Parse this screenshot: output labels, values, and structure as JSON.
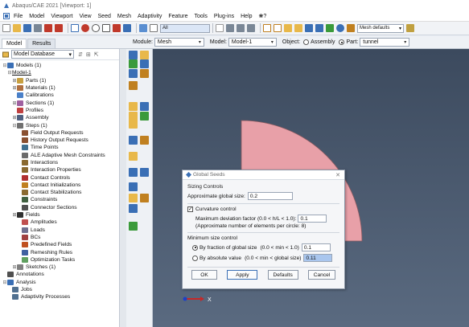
{
  "window": {
    "title": "Abaqus/CAE 2021 [Viewport: 1]"
  },
  "menubar": {
    "items": [
      "File",
      "Model",
      "Viewport",
      "View",
      "Seed",
      "Mesh",
      "Adaptivity",
      "Feature",
      "Tools",
      "Plug-ins",
      "Help",
      "❀?"
    ]
  },
  "toolbar": {
    "filter_value": "All",
    "mesh_defaults": "Mesh defaults"
  },
  "tabs": [
    {
      "label": "Model"
    },
    {
      "label": "Results"
    }
  ],
  "context": {
    "module_label": "Module:",
    "module_value": "Mesh",
    "model_label": "Model:",
    "model_value": "Model-1",
    "object_label": "Object:",
    "assembly_label": "Assembly",
    "part_label": "Part:",
    "part_value": "tunnel"
  },
  "tree": {
    "header": "Model Database",
    "nodes": [
      {
        "label": "Models (1)",
        "level": 0,
        "exp": "⊟",
        "color": "#3a6fb5"
      },
      {
        "label": "Model-1",
        "level": 1,
        "exp": "⊟",
        "color": "",
        "underline": true
      },
      {
        "label": "Parts (1)",
        "level": 2,
        "exp": "⊞",
        "color": "#c8a040"
      },
      {
        "label": "Materials (1)",
        "level": 2,
        "exp": "⊞",
        "color": "#b07040"
      },
      {
        "label": "Calibrations",
        "level": 2,
        "exp": "",
        "color": "#4a80c8"
      },
      {
        "label": "Sections (1)",
        "level": 2,
        "exp": "⊞",
        "color": "#a060a0"
      },
      {
        "label": "Profiles",
        "level": 2,
        "exp": "",
        "color": "#c04040"
      },
      {
        "label": "Assembly",
        "level": 2,
        "exp": "⊞",
        "color": "#506080"
      },
      {
        "label": "Steps (1)",
        "level": 2,
        "exp": "⊟",
        "color": "#707070"
      },
      {
        "label": "Field Output Requests",
        "level": 3,
        "exp": "",
        "color": "#8a5030"
      },
      {
        "label": "History Output Requests",
        "level": 3,
        "exp": "",
        "color": "#8a5030"
      },
      {
        "label": "Time Points",
        "level": 3,
        "exp": "",
        "color": "#407090"
      },
      {
        "label": "ALE Adaptive Mesh Constraints",
        "level": 3,
        "exp": "",
        "color": "#6a6a6a"
      },
      {
        "label": "Interactions",
        "level": 3,
        "exp": "",
        "color": "#8a6a30"
      },
      {
        "label": "Interaction Properties",
        "level": 3,
        "exp": "",
        "color": "#8a6a30"
      },
      {
        "label": "Contact Controls",
        "level": 3,
        "exp": "",
        "color": "#b03030"
      },
      {
        "label": "Contact Initializations",
        "level": 3,
        "exp": "",
        "color": "#c08020"
      },
      {
        "label": "Contact Stabilizations",
        "level": 3,
        "exp": "",
        "color": "#8a6a30"
      },
      {
        "label": "Constraints",
        "level": 3,
        "exp": "",
        "color": "#406040"
      },
      {
        "label": "Connector Sections",
        "level": 3,
        "exp": "",
        "color": "#505050"
      },
      {
        "label": "Fields",
        "level": 2,
        "exp": "⊞",
        "color": "#303030"
      },
      {
        "label": "Amplitudes",
        "level": 3,
        "exp": "",
        "color": "#c05050"
      },
      {
        "label": "Loads",
        "level": 3,
        "exp": "",
        "color": "#707090"
      },
      {
        "label": "BCs",
        "level": 3,
        "exp": "",
        "color": "#a04040"
      },
      {
        "label": "Predefined Fields",
        "level": 3,
        "exp": "",
        "color": "#c05020"
      },
      {
        "label": "Remeshing Rules",
        "level": 3,
        "exp": "",
        "color": "#4060a0"
      },
      {
        "label": "Optimization Tasks",
        "level": 3,
        "exp": "",
        "color": "#60a060"
      },
      {
        "label": "Sketches (1)",
        "level": 2,
        "exp": "⊞",
        "color": "#808080"
      },
      {
        "label": "Annotations",
        "level": 0,
        "exp": "",
        "color": "#505050"
      },
      {
        "label": "Analysis",
        "level": 0,
        "exp": "⊟",
        "color": "#3a6fb5"
      },
      {
        "label": "Jobs",
        "level": 1,
        "exp": "",
        "color": "#507090"
      },
      {
        "label": "Adaptivity Processes",
        "level": 1,
        "exp": "",
        "color": "#507090"
      }
    ]
  },
  "dialog": {
    "title": "Global Seeds",
    "sizing_section": "Sizing Controls",
    "approx_size_label": "Approximate global size:",
    "approx_size_value": "0.2",
    "curvature_label": "Curvature control",
    "max_dev_label": "Maximum deviation factor (0.0 < h/L < 1.0):",
    "max_dev_value": "0.1",
    "approx_elements_note": "(Approximate number of elements per circle: 8)",
    "min_size_section": "Minimum size control",
    "by_fraction_label": "By fraction of global size",
    "by_fraction_range": "(0.0 < min < 1.0)",
    "by_fraction_value": "0.1",
    "by_absolute_label": "By absolute value",
    "by_absolute_range": "(0.0 < min < global size)",
    "by_absolute_value": "0.11",
    "ok": "OK",
    "apply": "Apply",
    "defaults": "Defaults",
    "cancel": "Cancel"
  },
  "viewport": {
    "part_color": "#e8a0a8",
    "background": "#4a5a70",
    "axis_label": "X"
  }
}
